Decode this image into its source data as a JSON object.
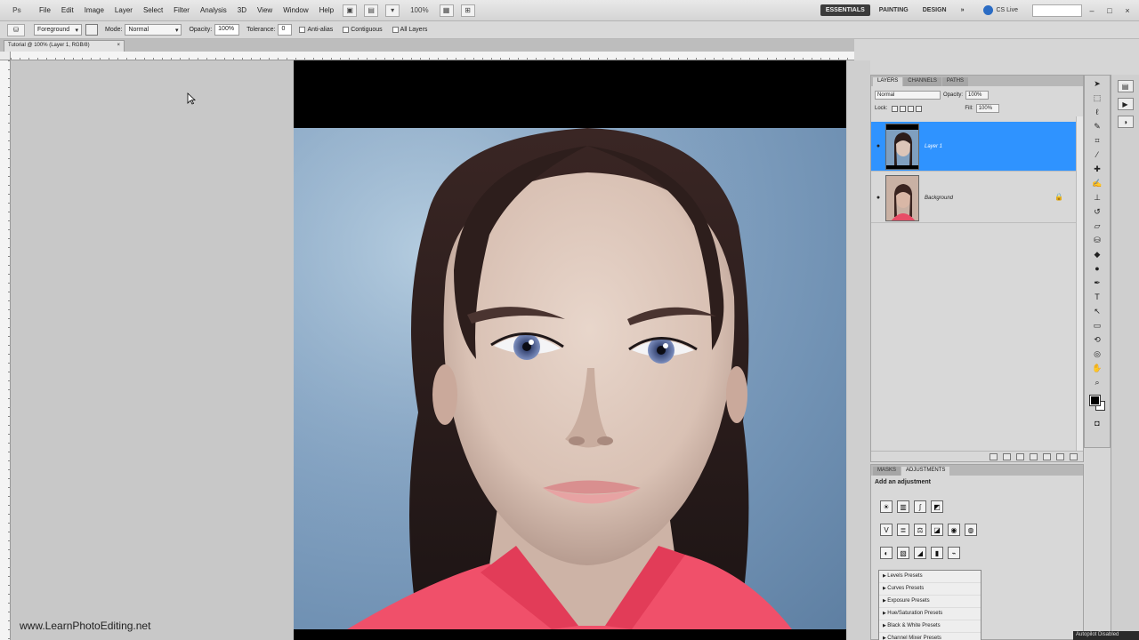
{
  "menubar": {
    "items": [
      "File",
      "Edit",
      "Image",
      "Layer",
      "Select",
      "Filter",
      "Analysis",
      "3D",
      "View",
      "Window",
      "Help"
    ],
    "zoom": "100%",
    "workspaces": [
      "ESSENTIALS",
      "PAINTING",
      "DESIGN"
    ],
    "more": "»",
    "cslive": "CS Live",
    "logo": "Ps"
  },
  "options": {
    "fill_source": "Foreground",
    "mode_label": "Mode:",
    "mode_value": "Normal",
    "opacity_label": "Opacity:",
    "opacity_value": "100%",
    "tolerance_label": "Tolerance:",
    "tolerance_value": "0",
    "antialias_label": "Anti-alias",
    "contiguous_label": "Contiguous",
    "alllayers_label": "All Layers"
  },
  "document": {
    "tab_title": "Tutorial @ 100% (Layer 1, RGB/8)",
    "tab_close": "×"
  },
  "layers_panel": {
    "tabs": [
      "LAYERS",
      "CHANNELS",
      "PATHS"
    ],
    "blend_mode": "Normal",
    "opacity_label": "Opacity:",
    "opacity_value": "100%",
    "lock_label": "Lock:",
    "fill_label": "Fill:",
    "fill_value": "100%",
    "layers": [
      {
        "name": "Layer 1",
        "selected": true
      },
      {
        "name": "Background",
        "selected": false
      }
    ]
  },
  "adjustments_panel": {
    "tabs": [
      "MASKS",
      "ADJUSTMENTS"
    ],
    "title": "Add an adjustment",
    "presets": [
      "Levels Presets",
      "Curves Presets",
      "Exposure Presets",
      "Hue/Saturation Presets",
      "Black & White Presets",
      "Channel Mixer Presets"
    ]
  },
  "watermark": "www.LearnPhotoEditing.net",
  "status_tag": "Autopilot Disabled",
  "colors": {
    "selected_layer": "#2f93ff",
    "active_workspace": "#3b3b3b"
  }
}
